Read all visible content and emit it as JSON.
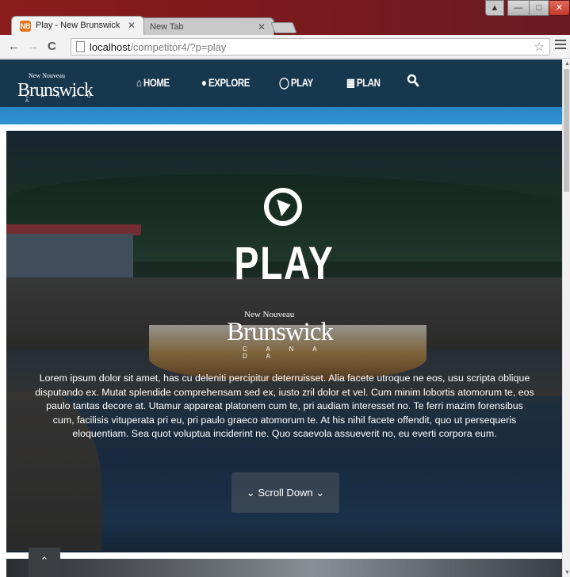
{
  "browser": {
    "tabs": [
      {
        "title": "Play - New Brunswick",
        "favicon": "NB"
      },
      {
        "title": "New Tab"
      }
    ],
    "url_host": "localhost",
    "url_path": "/competitor4/?p=play"
  },
  "site": {
    "logo": {
      "top": "New  Nouveau",
      "main": "Brunswick",
      "sub": "C A N A D A"
    },
    "nav": [
      {
        "label": "HOME",
        "icon": "home-icon"
      },
      {
        "label": "EXPLORE",
        "icon": "globe-icon"
      },
      {
        "label": "PLAY",
        "icon": "play-icon"
      },
      {
        "label": "PLAN",
        "icon": "map-icon"
      }
    ]
  },
  "hero": {
    "title": "PLAY",
    "logo": {
      "top": "New  Nouveau",
      "main": "Brunswick",
      "sub": "C A N A D A"
    },
    "text": "Lorem ipsum dolor sit amet, has cu deleniti percipitur deterruisset. Alia facete utroque ne eos, usu scripta oblique disputando ex. Mutat splendide comprehensam sed ex, iusto zril dolor et vel. Cum minim lobortis atomorum te, eos paulo tantas decore at. Utamur appareat platonem cum te, pri audiam interesset no. Te ferri mazim forensibus cum, facilisis vituperata pri eu, pri paulo graeco atomorum te. At his nihil facete offendit, quo ut persequeris eloquentiam. Sea quot voluptua inciderint ne. Quo scaevola assueverit no, eu everti corpora eum.",
    "scroll_label": "Scroll Down"
  },
  "colors": {
    "nav_bg": "#16374d",
    "strip": "#2f93d2",
    "title_bar": "#8a1c1c"
  }
}
